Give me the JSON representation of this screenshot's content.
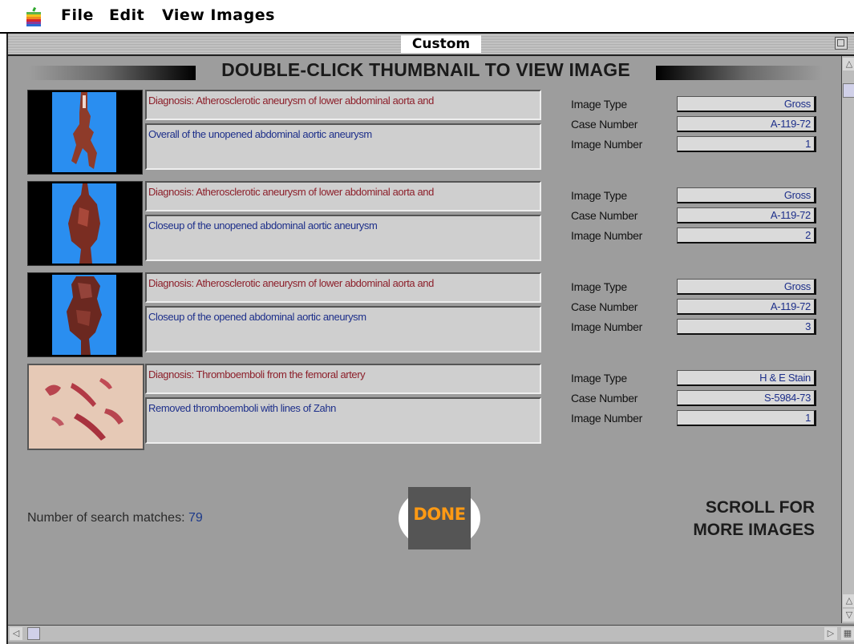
{
  "menubar": {
    "items": [
      "File",
      "Edit",
      "View Images"
    ]
  },
  "window": {
    "title": "Custom"
  },
  "header": {
    "instruction": "DOUBLE-CLICK THUMBNAIL TO VIEW IMAGE"
  },
  "labels": {
    "image_type": "Image Type",
    "case_number": "Case Number",
    "image_number": "Image Number"
  },
  "records": [
    {
      "diagnosis": "Diagnosis: Atherosclerotic aneurysm of lower abdominal aorta and",
      "description": "Overall of the unopened abdominal aortic aneurysm",
      "image_type": "Gross",
      "case_number": "A-119-72",
      "image_number": "1"
    },
    {
      "diagnosis": "Diagnosis: Atherosclerotic aneurysm of lower abdominal aorta and",
      "description": "Closeup of the unopened abdominal aortic aneurysm",
      "image_type": "Gross",
      "case_number": "A-119-72",
      "image_number": "2"
    },
    {
      "diagnosis": "Diagnosis: Atherosclerotic aneurysm of lower abdominal aorta and",
      "description": "Closeup of the opened abdominal aortic aneurysm",
      "image_type": "Gross",
      "case_number": "A-119-72",
      "image_number": "3"
    },
    {
      "diagnosis": "Diagnosis: Thromboemboli from the femoral artery",
      "description": "Removed thromboemboli with lines of Zahn",
      "image_type": "H & E Stain",
      "case_number": "S-5984-73",
      "image_number": "1"
    }
  ],
  "footer": {
    "matches_label": "Number of search matches:",
    "matches_count": "79",
    "done_label": "DONE",
    "scroll_hint_line1": "SCROLL FOR",
    "scroll_hint_line2": "MORE IMAGES"
  },
  "colors": {
    "diagnosis_text": "#8c1f2a",
    "description_text": "#1d2f8a",
    "done_text": "#ff9a14",
    "thumbnail_backdrop": "#2a8ef0"
  },
  "icons": {
    "apple_menu": "apple-icon",
    "zoom_box": "zoom-box-icon",
    "scroll_up": "arrow-up-icon",
    "scroll_down": "arrow-down-icon",
    "scroll_left": "arrow-left-icon",
    "scroll_right": "arrow-right-icon"
  }
}
